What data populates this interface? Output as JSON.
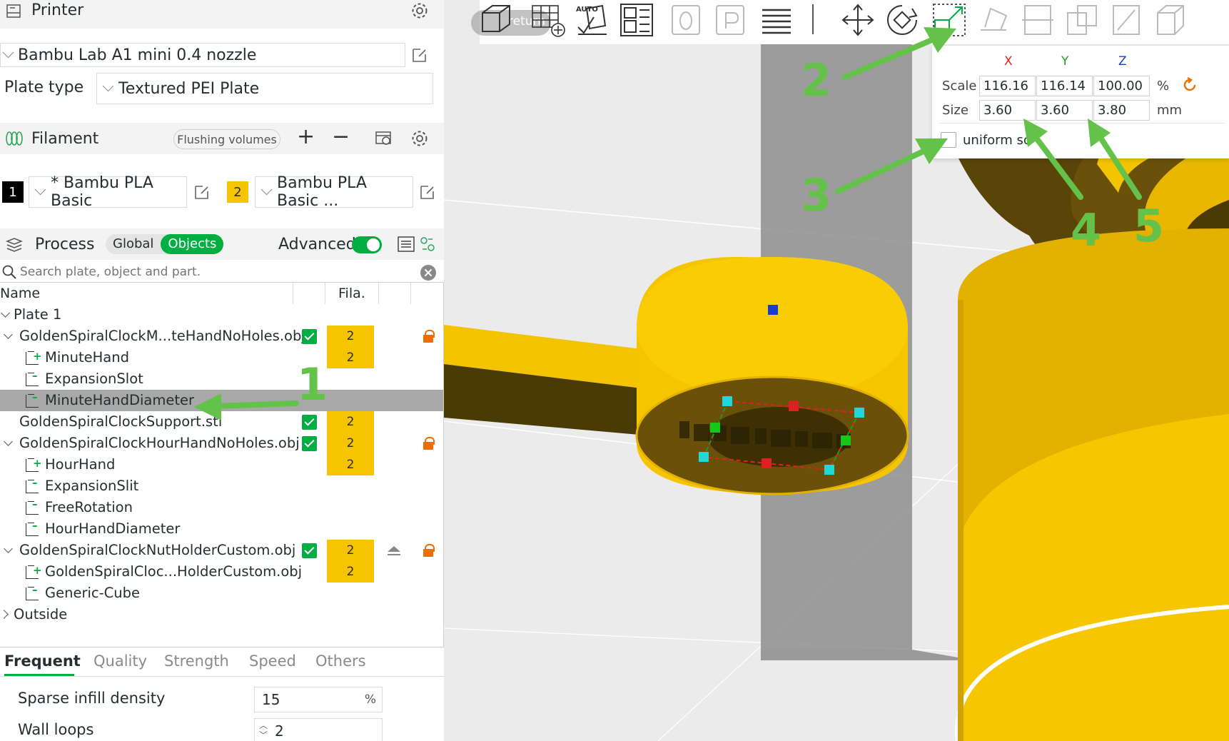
{
  "printer": {
    "title": "Printer",
    "model": "Bambu Lab A1 mini 0.4 nozzle",
    "plate_type_label": "Plate type",
    "plate_type": "Textured PEI Plate"
  },
  "filament": {
    "title": "Filament",
    "flushing_label": "Flushing volumes",
    "slots": [
      {
        "index": "1",
        "name": "* Bambu PLA Basic",
        "color": "#000000"
      },
      {
        "index": "2",
        "name": "Bambu PLA Basic ...",
        "color": "#f6c400"
      }
    ]
  },
  "process": {
    "title": "Process",
    "toggle_global": "Global",
    "toggle_objects": "Objects",
    "advanced_label": "Advanced"
  },
  "search": {
    "placeholder": "Search plate, object and part."
  },
  "tree": {
    "col_name": "Name",
    "col_fila": "Fila.",
    "nodes": [
      {
        "label": "Plate 1",
        "fila": ""
      },
      {
        "label": "GoldenSpiralClockM...teHandNoHoles.obj",
        "fila": "2"
      },
      {
        "label": "MinuteHand",
        "fila": "2"
      },
      {
        "label": "ExpansionSlot",
        "fila": ""
      },
      {
        "label": "MinuteHandDiameter",
        "fila": ""
      },
      {
        "label": "GoldenSpiralClockSupport.stl",
        "fila": "2"
      },
      {
        "label": "GoldenSpiralClockHourHandNoHoles.obj",
        "fila": "2"
      },
      {
        "label": "HourHand",
        "fila": "2"
      },
      {
        "label": "ExpansionSlit",
        "fila": ""
      },
      {
        "label": "FreeRotation",
        "fila": ""
      },
      {
        "label": "HourHandDiameter",
        "fila": ""
      },
      {
        "label": "GoldenSpiralClockNutHolderCustom.obj",
        "fila": "2"
      },
      {
        "label": "GoldenSpiralCloc...HolderCustom.obj",
        "fila": "2"
      },
      {
        "label": "Generic-Cube",
        "fila": ""
      },
      {
        "label": "Outside",
        "fila": ""
      }
    ]
  },
  "settings_tabs": [
    "Frequent",
    "Quality",
    "Strength",
    "Speed",
    "Others"
  ],
  "settings": {
    "sparse_infill_label": "Sparse infill density",
    "sparse_infill_value": "15",
    "sparse_infill_unit": "%",
    "wall_loops_label": "Wall loops",
    "wall_loops_value": "2"
  },
  "toolbar": {
    "return_label": "return",
    "auto_label": "AUTO"
  },
  "scale_popup": {
    "axis_x": "X",
    "axis_y": "Y",
    "axis_z": "Z",
    "scale_label": "Scale",
    "scale_x": "116.16",
    "scale_y": "116.14",
    "scale_z": "100.00",
    "scale_unit": "%",
    "size_label": "Size",
    "size_x": "3.60",
    "size_y": "3.60",
    "size_z": "3.80",
    "size_unit": "mm",
    "uniform_label": "uniform sc"
  },
  "annotations": [
    "1",
    "2",
    "3",
    "4",
    "5"
  ],
  "colors": {
    "accent_green": "#00ae42",
    "filament_yellow": "#f6c400",
    "arrow_green": "#64c24a",
    "axis_x": "#e02020",
    "axis_y": "#18a018",
    "axis_z": "#1a3ccc"
  }
}
